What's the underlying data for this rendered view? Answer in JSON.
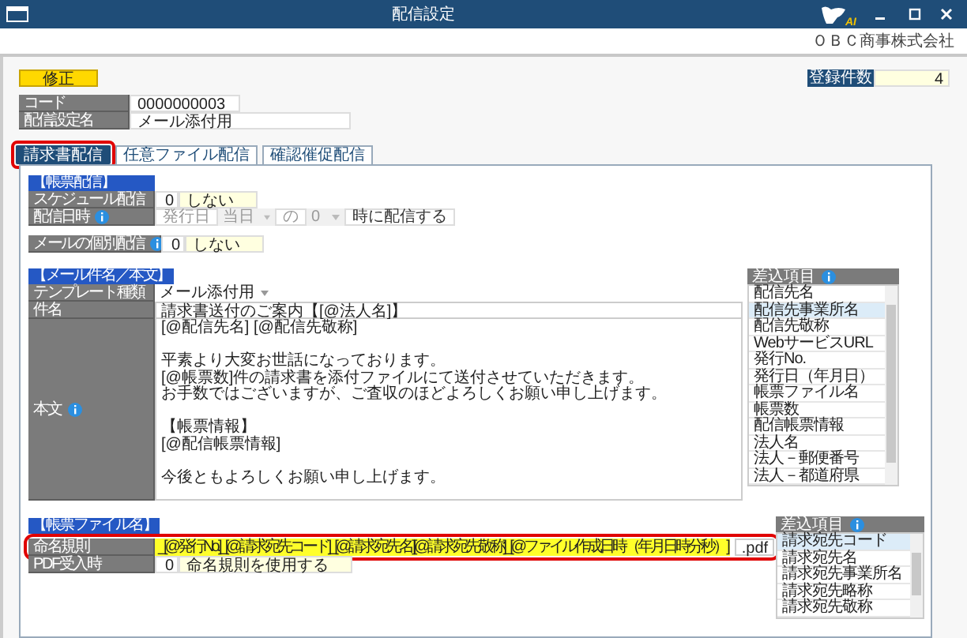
{
  "window": {
    "title": "配信設定",
    "logo_text": "AI",
    "company": "ＯＢＣ商事株式会社"
  },
  "mode_badge": "修正",
  "count": {
    "label": "登録件数",
    "value": "4"
  },
  "header_fields": [
    {
      "label": "コード",
      "value": "0000000003"
    },
    {
      "label": "配信設定名",
      "value": "メール添付用"
    }
  ],
  "tabs": [
    {
      "label": "請求書配信",
      "selected": true,
      "highlighted": true
    },
    {
      "label": "任意ファイル配信",
      "selected": false,
      "highlighted": false
    },
    {
      "label": "確認催促配信",
      "selected": false,
      "highlighted": false
    }
  ],
  "delivery": {
    "heading": "【帳票配信】",
    "schedule": {
      "label": "スケジュール配信",
      "code": "0",
      "value": "しない"
    },
    "datetime": {
      "label": "配信日時",
      "parts": [
        {
          "kind": "text",
          "text": "発行日",
          "disabled": true
        },
        {
          "kind": "select",
          "text": "当日",
          "disabled": true
        },
        {
          "kind": "text",
          "text": "の",
          "disabled": true
        },
        {
          "kind": "select",
          "text": "0",
          "disabled": true
        },
        {
          "kind": "text",
          "text": "時に配信する",
          "disabled": false
        }
      ]
    },
    "individual": {
      "label": "メールの個別配信",
      "code": "0",
      "value": "しない"
    }
  },
  "mail": {
    "heading": "【メール件名／本文】",
    "template": {
      "label": "テンプレート種類",
      "value": "メール添付用"
    },
    "subject": {
      "label": "件名",
      "value": "請求書送付のご案内【[@法人名]】"
    },
    "body": {
      "label": "本文",
      "paragraphs": [
        [
          "[@配信先名] [@配信先敬称]"
        ],
        [
          "平素より大変お世話になっております。",
          "[@帳票数]件の請求書を添付ファイルにて送付させていただきます。",
          "お手数ではございますが、ご査収のほどよろしくお願い申し上げます。"
        ],
        [
          "【帳票情報】",
          "[@配信帳票情報]"
        ],
        [
          "今後ともよろしくお願い申し上げます。"
        ]
      ]
    },
    "insert_list": {
      "heading": "差込項目",
      "items": [
        {
          "label": "配信先名",
          "selected": false
        },
        {
          "label": "配信先事業所名",
          "selected": true
        },
        {
          "label": "配信先敬称",
          "selected": false
        },
        {
          "label": "WebサービスURL",
          "selected": false
        },
        {
          "label": "発行No.",
          "selected": false
        },
        {
          "label": "発行日（年月日）",
          "selected": false
        },
        {
          "label": "帳票ファイル名",
          "selected": false
        },
        {
          "label": "帳票数",
          "selected": false
        },
        {
          "label": "配信帳票情報",
          "selected": false
        },
        {
          "label": "法人名",
          "selected": false
        },
        {
          "label": "法人－郵便番号",
          "selected": false
        },
        {
          "label": "法人－都道府県",
          "selected": false
        }
      ]
    }
  },
  "file_name": {
    "heading": "【帳票ファイル名】",
    "naming": {
      "label": "命名規則",
      "value": "_[@発行No.]_[@請求宛先コード]_[@請求宛先名][@請求宛先敬称]_[@ファイル作成日時（年月日時分秒）]",
      "suffix": ".pdf",
      "highlighted": true
    },
    "pdf": {
      "label": "PDF受入時",
      "code": "0",
      "value": "命名規則を使用する"
    },
    "insert_list": {
      "heading": "差込項目",
      "items": [
        {
          "label": "請求宛先コード",
          "selected": true
        },
        {
          "label": "請求宛先名",
          "selected": false
        },
        {
          "label": "請求宛先事業所名",
          "selected": false
        },
        {
          "label": "請求宛先略称",
          "selected": false
        },
        {
          "label": "請求宛先敬称",
          "selected": false
        }
      ]
    }
  }
}
